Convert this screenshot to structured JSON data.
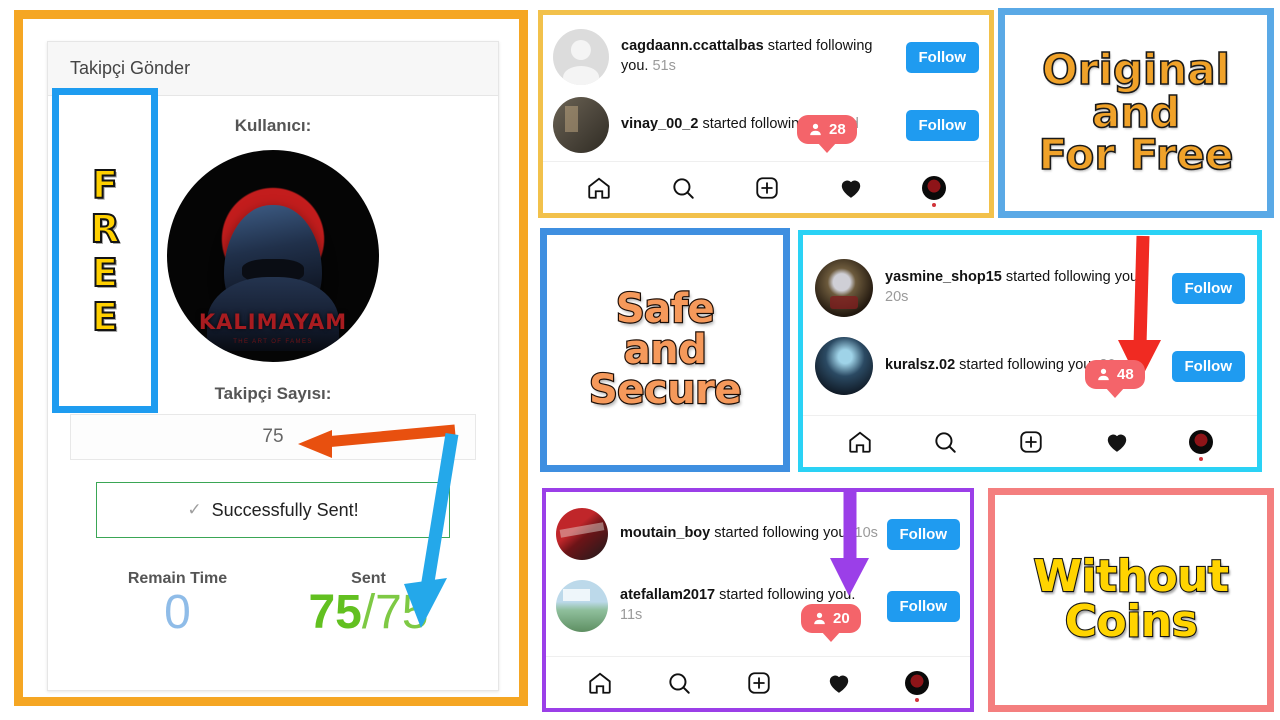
{
  "app_panel": {
    "header_title": "Takipçi Gönder",
    "user_label": "Kullanıcı:",
    "profile_name": "KALIMAYAM",
    "profile_subtitle": "THE ART OF FAMES",
    "count_label": "Takipçi Sayısı:",
    "count_value": "75",
    "success_icon": "check-icon",
    "success_text": "Successfully Sent!",
    "remain_label": "Remain Time",
    "remain_value": "0",
    "sent_label": "Sent",
    "sent_done": "75",
    "sent_sep": "/",
    "sent_total": "75",
    "free_letters": [
      "F",
      "R",
      "E",
      "E"
    ],
    "colors": {
      "frame": "#f5a623",
      "free_border": "#1e9cf0",
      "free_letter": "#ffd000",
      "success_border": "#3aa655",
      "sent_green": "#62c020",
      "remain_blue": "#8fbce8"
    }
  },
  "callouts": [
    {
      "name": "original-and-for-free",
      "lines": [
        "Original",
        "and",
        "For Free"
      ],
      "border": "#5aa9e6",
      "text_color": "#f0a229"
    },
    {
      "name": "safe-and-secure",
      "lines": [
        "Safe",
        "and",
        "Secure"
      ],
      "border": "#3f8fe0",
      "text_color": "#f5995b"
    },
    {
      "name": "without-coins",
      "lines": [
        "Without",
        "Coins"
      ],
      "border": "#f47f7f",
      "text_color": "#ffd400"
    }
  ],
  "ig_panels": [
    {
      "name": "ig-panel-top",
      "border": "#f2c14b",
      "rows": [
        {
          "avatar": "generic",
          "user": "cagdaann.ccattalbas",
          "action": "started following you.",
          "time": "51s",
          "follow": "Follow"
        },
        {
          "avatar": "av-vinay",
          "user": "vinay_00_2",
          "action": "started following you.",
          "time": "2d",
          "follow": "Follow"
        }
      ],
      "badge": {
        "icon": "person-icon",
        "count": "28"
      },
      "nav": [
        "home-icon",
        "search-icon",
        "add-icon",
        "heart-icon",
        "profile-avatar"
      ]
    },
    {
      "name": "ig-panel-middle",
      "border": "#2ad2f5",
      "rows": [
        {
          "avatar": "av-yasmine",
          "user": "yasmine_shop15",
          "action": "started following you.",
          "time": "20s",
          "follow": "Follow"
        },
        {
          "avatar": "av-kuralsz",
          "user": "kuralsz.02",
          "action": "started following you.",
          "time": "20s",
          "follow": "Follow"
        }
      ],
      "badge": {
        "icon": "person-icon",
        "count": "48"
      },
      "nav": [
        "home-icon",
        "search-icon",
        "add-icon",
        "heart-icon",
        "profile-avatar"
      ]
    },
    {
      "name": "ig-panel-bottom",
      "border": "#9b3fe8",
      "rows": [
        {
          "avatar": "av-moutain",
          "user": "moutain_boy",
          "action": "started following you.",
          "time": "10s",
          "follow": "Follow"
        },
        {
          "avatar": "av-atefallam",
          "user": "atefallam2017",
          "action": "started following you.",
          "time": "11s",
          "follow": "Follow"
        }
      ],
      "badge": {
        "icon": "person-icon",
        "count": "20"
      },
      "nav": [
        "home-icon",
        "search-icon",
        "add-icon",
        "heart-icon",
        "profile-avatar"
      ]
    }
  ],
  "arrows": [
    {
      "name": "orange-arrow-to-count",
      "color": "#e8500f"
    },
    {
      "name": "blue-arrow-to-sent",
      "color": "#24a8ea"
    },
    {
      "name": "red-arrow-to-badge",
      "color": "#f02a22"
    },
    {
      "name": "purple-arrow-to-badge",
      "color": "#9b3fe8"
    }
  ]
}
